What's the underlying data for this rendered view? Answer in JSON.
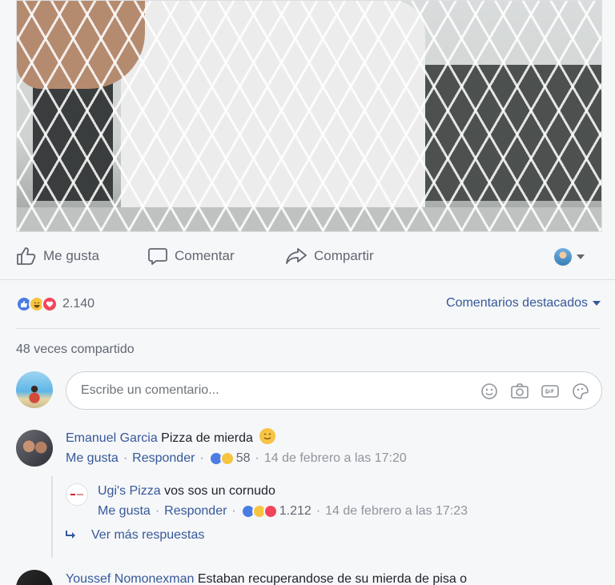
{
  "post": {
    "actions": {
      "like": "Me gusta",
      "comment": "Comentar",
      "share": "Compartir"
    },
    "reaction_count": "2.140",
    "sort_label": "Comentarios destacados",
    "shares": "48 veces compartido"
  },
  "composer": {
    "placeholder": "Escribe un comentario..."
  },
  "comments": [
    {
      "author": "Emanuel Garcia",
      "text": "Pizza de mierda",
      "like_label": "Me gusta",
      "reply_label": "Responder",
      "reaction_count": "58",
      "time": "14 de febrero a las 17:20"
    },
    {
      "author": "Youssef Nomonexman",
      "text": "Estaban recuperandose de su mierda de pisa o"
    }
  ],
  "reply": {
    "author": "Ugi's Pizza",
    "text": "vos sos un cornudo",
    "like_label": "Me gusta",
    "reply_label": "Responder",
    "reaction_count": "1.212",
    "time": "14 de febrero a las 17:23"
  },
  "more_replies": "Ver más respuestas",
  "colors": {
    "link": "#365899",
    "meta": "#606770",
    "like": "#4a7ce2",
    "haha": "#f7c442",
    "love": "#f2455b"
  }
}
